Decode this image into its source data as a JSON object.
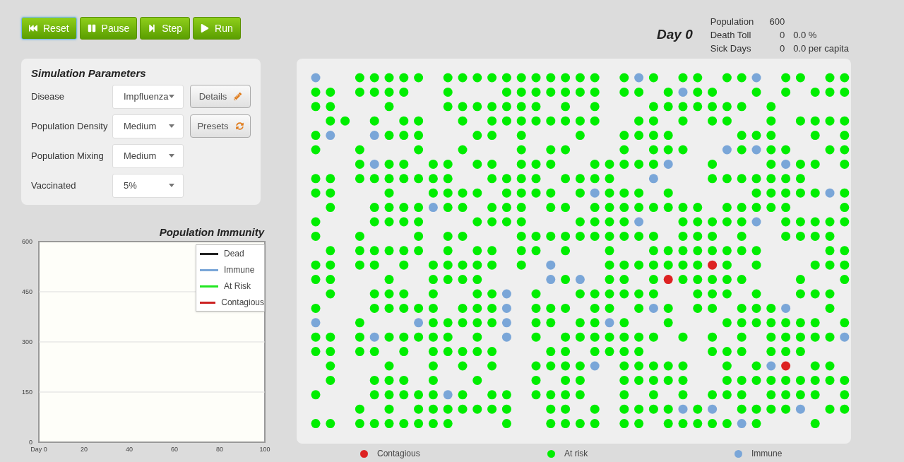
{
  "toolbar": [
    {
      "kind": "reset",
      "label": "Reset",
      "focused": true
    },
    {
      "kind": "pause",
      "label": "Pause",
      "focused": false
    },
    {
      "kind": "step",
      "label": "Step",
      "focused": false
    },
    {
      "kind": "run",
      "label": "Run",
      "focused": false
    }
  ],
  "parameters": {
    "title": "Simulation Parameters",
    "rows": [
      {
        "label": "Disease",
        "value": "Impfluenza",
        "action": {
          "kind": "edit",
          "label": "Details"
        }
      },
      {
        "label": "Population Density",
        "value": "Medium",
        "action": {
          "kind": "refresh",
          "label": "Presets"
        }
      },
      {
        "label": "Population Mixing",
        "value": "Medium"
      },
      {
        "label": "Vaccinated",
        "value": "5%"
      }
    ]
  },
  "chart": {
    "title": "Population Immunity",
    "chart_data": {
      "type": "line",
      "grid": true,
      "ylim": [
        0,
        600
      ],
      "yticks": [
        0,
        150,
        300,
        450,
        600
      ],
      "categories": [
        "Day 0",
        "20",
        "40",
        "60",
        "80",
        "100"
      ],
      "series": [
        {
          "name": "Dead",
          "color": "#222222",
          "values": [
            null,
            null,
            null,
            null,
            null,
            null
          ]
        },
        {
          "name": "Immune",
          "color": "#7aa6d8",
          "values": [
            null,
            null,
            null,
            null,
            null,
            null
          ]
        },
        {
          "name": "At Risk",
          "color": "#22e622",
          "values": [
            null,
            null,
            null,
            null,
            null,
            null
          ]
        },
        {
          "name": "Contagious",
          "color": "#cc2222",
          "values": [
            null,
            null,
            null,
            null,
            null,
            null
          ]
        }
      ]
    }
  },
  "day": "Day 0",
  "stats": [
    {
      "label": "Population",
      "value": "600"
    },
    {
      "label": "Death Toll",
      "value": "0",
      "extra": "0.0 %"
    },
    {
      "label": "Sick Days",
      "value": "0",
      "extra": "0.0 per capita"
    }
  ],
  "legend": [
    {
      "label": "Contagious",
      "color": "#dd2222"
    },
    {
      "label": "At risk",
      "color": "#00ee00"
    },
    {
      "label": "Immune",
      "color": "#7aa6d8"
    }
  ]
}
